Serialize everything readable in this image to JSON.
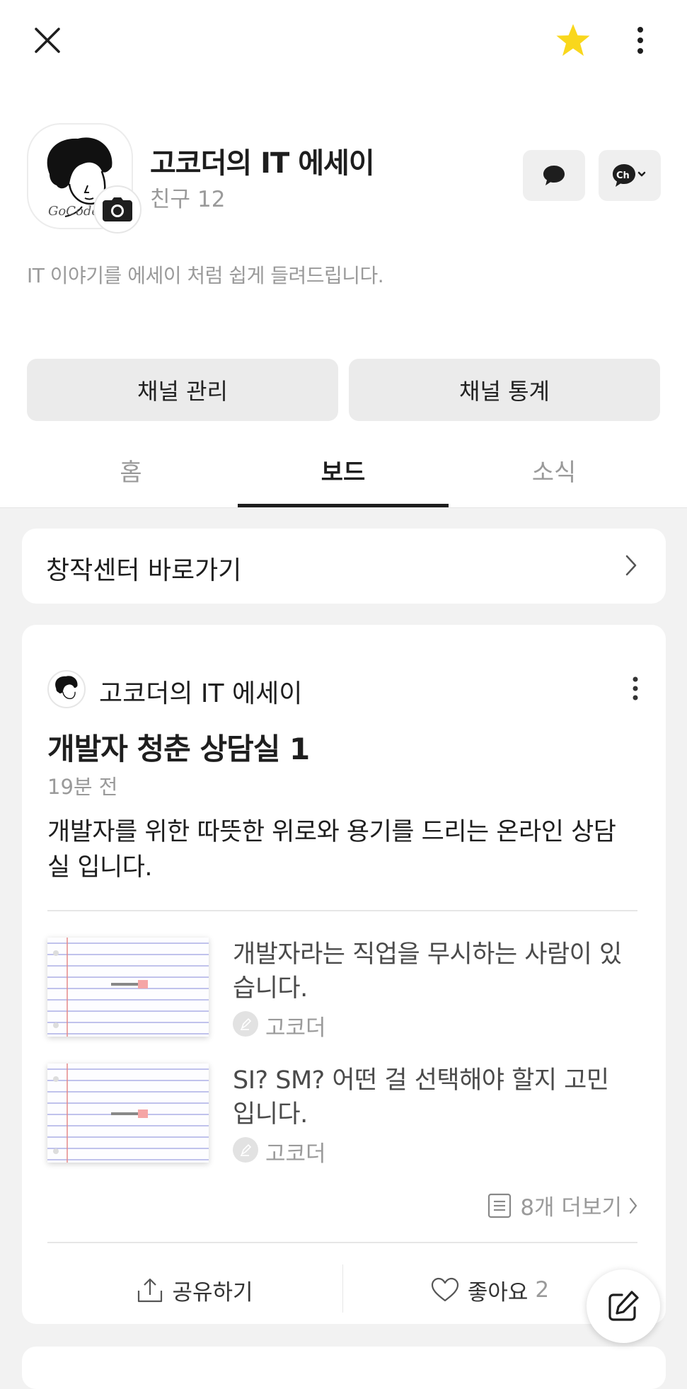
{
  "profile": {
    "channel_name": "고코더의 IT 에세이",
    "friend_label": "친구",
    "friend_count": "12",
    "description": "IT 이야기를 에세이 처럼 쉽게 들려드립니다.",
    "avatar_text": "GoCoder"
  },
  "actions": {
    "manage_label": "채널 관리",
    "stats_label": "채널 통계"
  },
  "tabs": [
    {
      "label": "홈"
    },
    {
      "label": "보드"
    },
    {
      "label": "소식"
    }
  ],
  "creator_center": {
    "label": "창작센터 바로가기"
  },
  "post": {
    "author": "고코더의 IT 에세이",
    "title": "개발자 청춘 상담실 1",
    "time": "19분 전",
    "body": "개발자를 위한 따뜻한 위로와 용기를 드리는 온라인 상담실 입니다.",
    "articles": [
      {
        "title": "개발자라는 직업을 무시하는 사람이 있습니다.",
        "author": "고코더"
      },
      {
        "title": "SI? SM? 어떤 걸 선택해야 할지 고민입니다.",
        "author": "고코더"
      }
    ],
    "more_label": "8개 더보기",
    "share_label": "공유하기",
    "like_label": "좋아요",
    "like_count": "2"
  },
  "colors": {
    "star": "#f9d71c",
    "background": "#f2f2f2",
    "tab_active": "#1e1e1e"
  },
  "icons": [
    "close-icon",
    "star-icon",
    "more-vertical-icon",
    "camera-icon",
    "chat-bubble-icon",
    "channel-icon",
    "chevron-right-icon",
    "list-icon",
    "share-icon",
    "heart-icon",
    "edit-icon"
  ]
}
